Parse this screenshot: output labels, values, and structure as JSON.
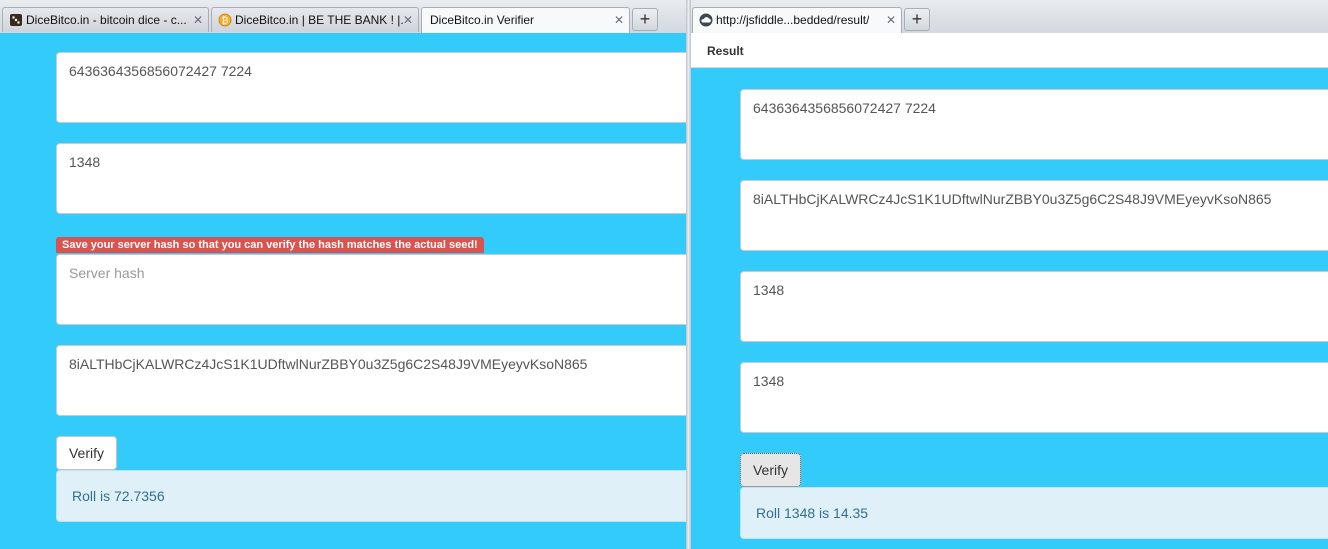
{
  "left_window": {
    "tabs": [
      {
        "title": "DiceBitco.in - bitcoin dice - c...",
        "icon": "dice-icon"
      },
      {
        "title": "DiceBitco.in | BE THE BANK ! |...",
        "icon": "bitcoin-coin-icon"
      },
      {
        "title": "DiceBitco.in Verifier",
        "icon": ""
      }
    ],
    "tab_close_glyph": "✕",
    "new_tab_glyph": "+",
    "form": {
      "client_seed_value": "6436364356856072427 7224",
      "nonce_value": "1348",
      "server_hash_warning": "Save your server hash so that you can verify the hash matches the actual seed!",
      "server_hash_placeholder": "Server hash",
      "server_seed_value": "8iALTHbCjKALWRCz4JcS1K1UDftwlNurZBBY0u3Z5g6C2S48J9VMEyeyvKsoN865",
      "verify_label": "Verify",
      "result_text": "Roll is 72.7356"
    }
  },
  "right_window": {
    "tab": {
      "title": "http://jsfiddle...bedded/result/",
      "icon": "cloud-icon"
    },
    "tab_close_glyph": "✕",
    "new_tab_glyph": "+",
    "result_label": "Result",
    "form": {
      "field1_value": "6436364356856072427 7224",
      "field2_value": "8iALTHbCjKALWRCz4JcS1K1UDftwlNurZBBY0u3Z5g6C2S48J9VMEyeyvKsoN865",
      "field3_value": "1348",
      "field4_value": "1348",
      "verify_label": "Verify",
      "result_text": "Roll 1348 is 14.35"
    }
  },
  "colors": {
    "page_background": "#33ccfa",
    "warning_badge": "#d9534f",
    "result_alert_bg": "#dff0f8",
    "result_alert_text": "#31708f"
  }
}
